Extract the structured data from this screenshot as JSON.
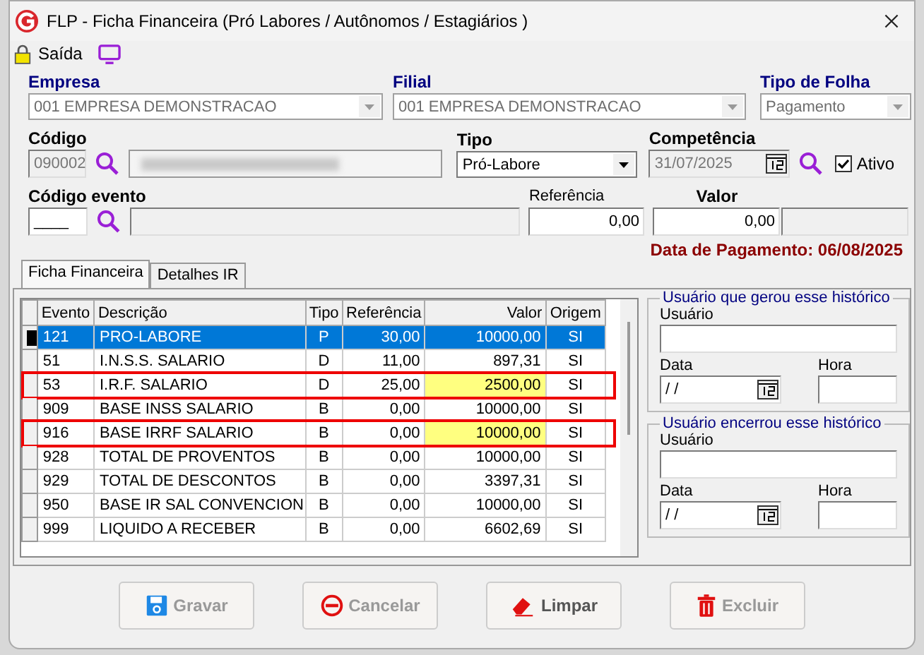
{
  "window": {
    "title": "FLP - Ficha Financeira (Pró Labores / Autônomos / Estagiários )"
  },
  "toolbar": {
    "exit_label": "Saída"
  },
  "header": {
    "empresa": {
      "label": "Empresa",
      "value": "001 EMPRESA DEMONSTRACAO",
      "disabled": true
    },
    "filial": {
      "label": "Filial",
      "value": "001 EMPRESA DEMONSTRACAO",
      "disabled": true
    },
    "tipo_folha": {
      "label": "Tipo de Folha",
      "value": "Pagamento",
      "disabled": true
    },
    "codigo": {
      "label": "Código",
      "value": "090002",
      "disabled": true
    },
    "tipo": {
      "label": "Tipo",
      "value": "Pró-Labore",
      "disabled": false
    },
    "competencia": {
      "label": "Competência",
      "value": "31/07/2025",
      "disabled": true
    },
    "ativo": {
      "label": "Ativo",
      "checked": true
    },
    "codigo_evento": {
      "label": "Código evento",
      "value": "____"
    },
    "referencia": {
      "label": "Referência",
      "value": "0,00"
    },
    "valor": {
      "label": "Valor",
      "value": "0,00"
    },
    "data_pagamento": "Data de Pagamento: 06/08/2025"
  },
  "tabs": [
    {
      "label": "Ficha Financeira",
      "selected": true
    },
    {
      "label": "Detalhes IR",
      "selected": false
    }
  ],
  "table": {
    "columns": [
      "Evento",
      "Descrição",
      "Tipo",
      "Referência",
      "Valor",
      "Origem"
    ],
    "rows": [
      {
        "cells": [
          "121",
          "PRO-LABORE",
          "P",
          "30,00",
          "10000,00",
          "SI"
        ],
        "selected": true,
        "outlined": false,
        "value_highlighted": false
      },
      {
        "cells": [
          "51",
          "I.N.S.S. SALARIO",
          "D",
          "11,00",
          "897,31",
          "SI"
        ],
        "selected": false,
        "outlined": false,
        "value_highlighted": false
      },
      {
        "cells": [
          "53",
          "I.R.F. SALARIO",
          "D",
          "25,00",
          "2500,00",
          "SI"
        ],
        "selected": false,
        "outlined": true,
        "value_highlighted": true
      },
      {
        "cells": [
          "909",
          "BASE INSS SALARIO",
          "B",
          "0,00",
          "10000,00",
          "SI"
        ],
        "selected": false,
        "outlined": false,
        "value_highlighted": false
      },
      {
        "cells": [
          "916",
          "BASE IRRF SALARIO",
          "B",
          "0,00",
          "10000,00",
          "SI"
        ],
        "selected": false,
        "outlined": true,
        "value_highlighted": true
      },
      {
        "cells": [
          "928",
          "TOTAL DE PROVENTOS",
          "B",
          "0,00",
          "10000,00",
          "SI"
        ],
        "selected": false,
        "outlined": false,
        "value_highlighted": false
      },
      {
        "cells": [
          "929",
          "TOTAL DE DESCONTOS",
          "B",
          "0,00",
          "3397,31",
          "SI"
        ],
        "selected": false,
        "outlined": false,
        "value_highlighted": false
      },
      {
        "cells": [
          "950",
          "BASE IR SAL CONVENCION",
          "B",
          "0,00",
          "10000,00",
          "SI"
        ],
        "selected": false,
        "outlined": false,
        "value_highlighted": false
      },
      {
        "cells": [
          "999",
          "LIQUIDO A RECEBER",
          "B",
          "0,00",
          "6602,69",
          "SI"
        ],
        "selected": false,
        "outlined": false,
        "value_highlighted": false
      }
    ]
  },
  "history_groups": [
    {
      "title": "Usuário que gerou esse histórico",
      "user_label": "Usuário",
      "date_label": "Data",
      "date_value": "/ /",
      "time_label": "Hora"
    },
    {
      "title": "Usuário encerrou esse histórico",
      "user_label": "Usuário",
      "date_label": "Data",
      "date_value": "/ /",
      "time_label": "Hora"
    }
  ],
  "buttons": [
    {
      "label": "Gravar",
      "kind": "save",
      "disabled": true
    },
    {
      "label": "Cancelar",
      "kind": "cancel",
      "disabled": true
    },
    {
      "label": "Limpar",
      "kind": "clear",
      "disabled": false
    },
    {
      "label": "Excluir",
      "kind": "delete",
      "disabled": true
    }
  ]
}
